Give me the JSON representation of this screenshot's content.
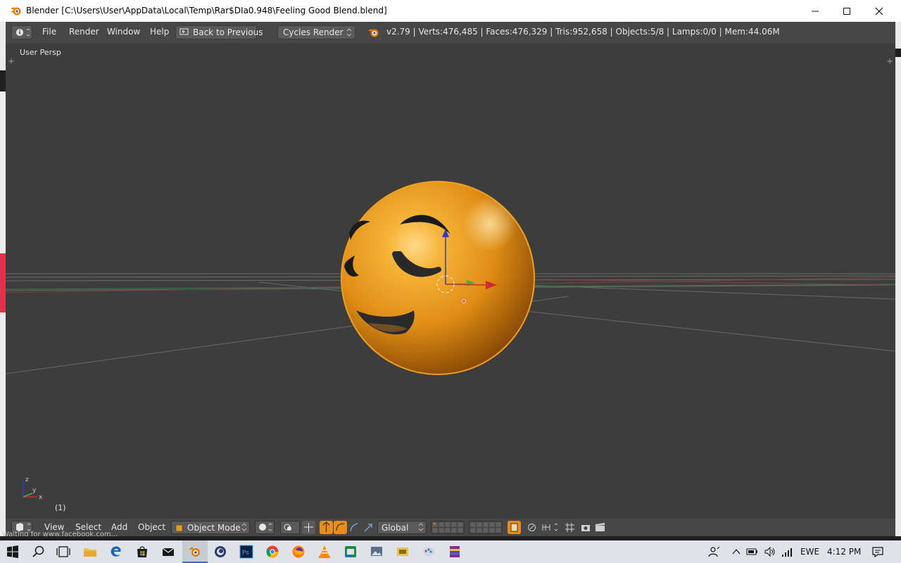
{
  "window": {
    "title": "Blender [C:\\Users\\User\\AppData\\Local\\Temp\\Rar$DIa0.948\\Feeling Good Blend.blend]",
    "controls": [
      "minimize-icon",
      "maximize-icon",
      "close-icon"
    ]
  },
  "infobar": {
    "menus": [
      "File",
      "Render",
      "Window",
      "Help"
    ],
    "back_button": "Back to Previous",
    "render_engine": "Cycles Render",
    "stats": "v2.79 | Verts:476,485 | Faces:476,329 | Tris:952,658 | Objects:5/8 | Lamps:0/0 | Mem:44.06M"
  },
  "viewport": {
    "view_label": "User Persp",
    "frame_label": "(1)",
    "axis_labels": {
      "z": "z",
      "x": "x",
      "y": "y"
    },
    "object_color": "#e89a1c",
    "background_color": "#3d3d3d"
  },
  "header": {
    "menus": [
      "View",
      "Select",
      "Add",
      "Object"
    ],
    "mode": "Object Mode",
    "orientation": "Global"
  },
  "status": {
    "overlay_text": "Waiting for www.facebook.com..."
  },
  "taskbar": {
    "apps": [
      "start-icon",
      "search-icon",
      "task-view-icon",
      "file-explorer-icon",
      "edge-icon",
      "store-icon",
      "mail-icon",
      "blender-taskbar-icon",
      "cinema4d-icon",
      "photoshop-icon",
      "chrome-icon",
      "firefox-icon",
      "vlc-icon",
      "app-green-icon",
      "app-photos-icon",
      "app-folder-icon",
      "app-paint-icon",
      "app-winrar-icon"
    ],
    "language": "EWE",
    "time": "4:12 PM"
  },
  "colors": {
    "accent_orange": "#e87d0d",
    "infobar_bg": "#474747",
    "axis_x": "#d12b2b",
    "axis_y": "#3bb34a",
    "axis_z": "#2440c9"
  }
}
